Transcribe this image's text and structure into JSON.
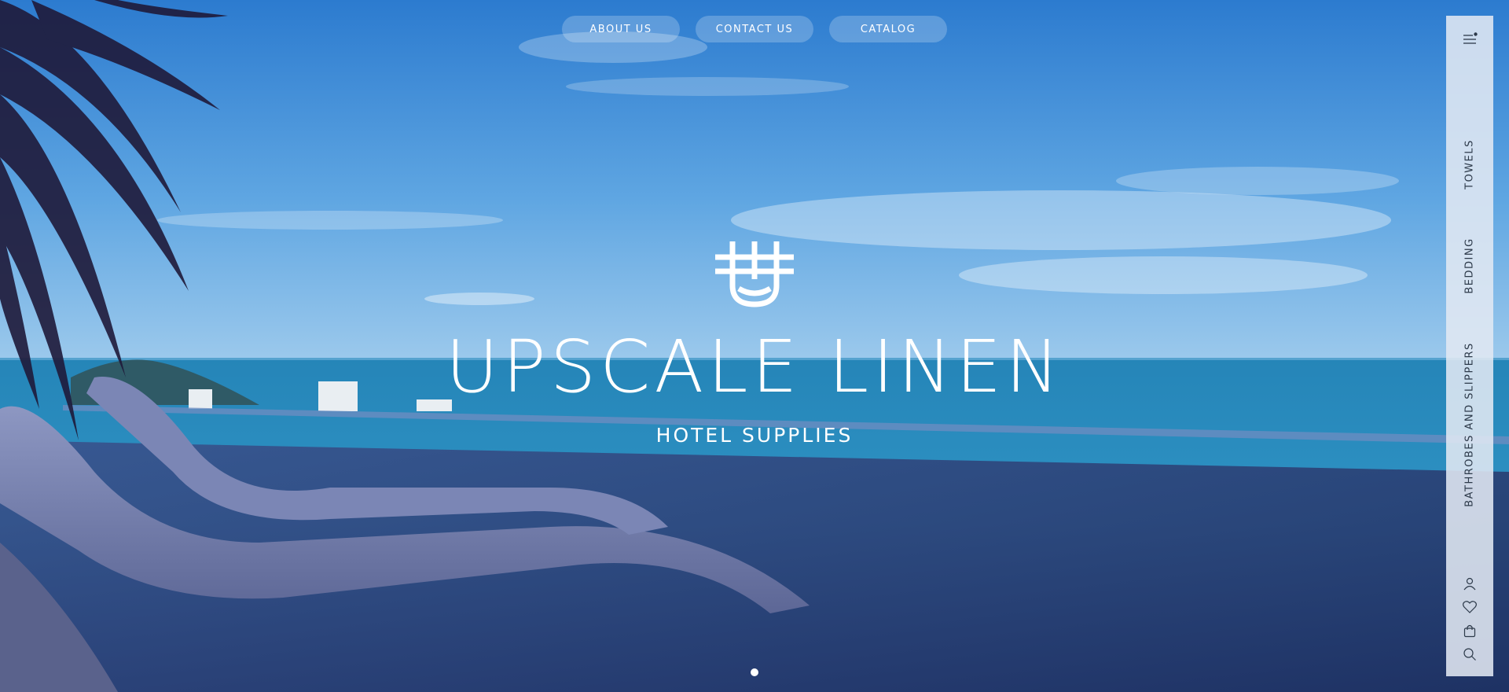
{
  "nav": {
    "about": "ABOUT US",
    "contact": "CONTACT US",
    "catalog": "CATALOG"
  },
  "brand": {
    "title": "UPSCALE LINEN",
    "subtitle": "HOTEL SUPPLIES"
  },
  "side_panel": {
    "links": [
      "TOWELS",
      "BEDDING",
      "BATHROBES AND SLIPPERS"
    ],
    "icons": [
      "menu-icon",
      "user-icon",
      "heart-icon",
      "bag-icon",
      "search-icon"
    ]
  },
  "slider": {
    "slide_count": 1,
    "active_slide": 1
  },
  "colors": {
    "text_light": "#ffffff",
    "panel_text": "#2d3a4a",
    "panel_bg": "#e1e8f2"
  }
}
